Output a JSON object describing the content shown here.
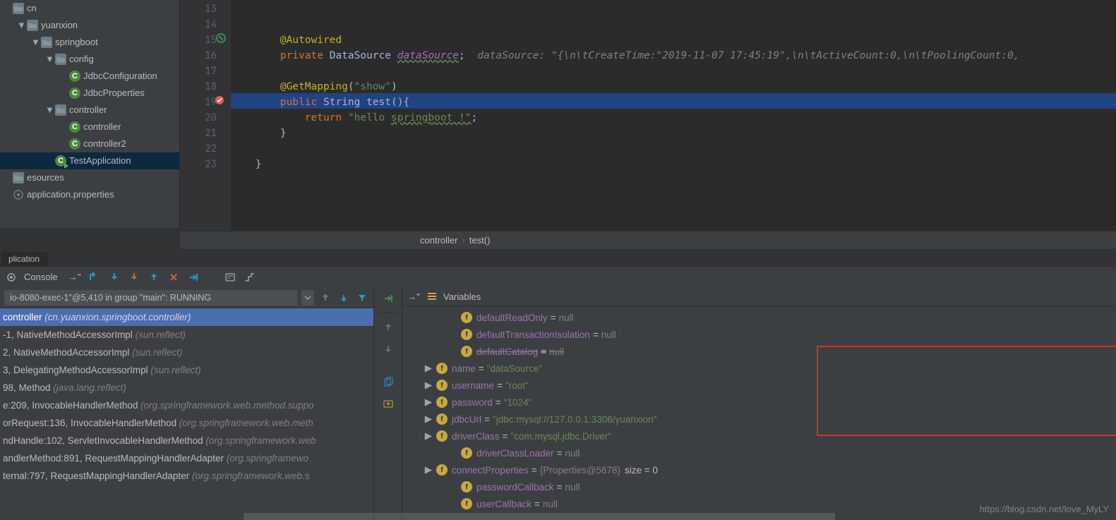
{
  "tree": {
    "items": [
      {
        "depth": 0,
        "chevron": "",
        "iconType": "pkg",
        "label": "cn"
      },
      {
        "depth": 1,
        "chevron": "▼",
        "iconType": "pkg",
        "label": "yuanxion"
      },
      {
        "depth": 2,
        "chevron": "▼",
        "iconType": "pkg",
        "label": "springboot"
      },
      {
        "depth": 3,
        "chevron": "▼",
        "iconType": "pkg",
        "label": "config"
      },
      {
        "depth": 4,
        "chevron": "",
        "iconType": "cls",
        "label": "JdbcConfiguration"
      },
      {
        "depth": 4,
        "chevron": "",
        "iconType": "cls",
        "label": "JdbcProperties"
      },
      {
        "depth": 3,
        "chevron": "▼",
        "iconType": "pkg",
        "label": "controller"
      },
      {
        "depth": 4,
        "chevron": "",
        "iconType": "cls",
        "label": "controller"
      },
      {
        "depth": 4,
        "chevron": "",
        "iconType": "cls",
        "label": "controller2"
      },
      {
        "depth": 3,
        "chevron": "",
        "iconType": "run",
        "label": "TestApplication",
        "selected": true
      },
      {
        "depth": 0,
        "chevron": "",
        "iconType": "pkg",
        "label": "esources"
      },
      {
        "depth": 0,
        "chevron": "",
        "iconType": "prop",
        "label": "application.properties"
      }
    ]
  },
  "gutter": {
    "lines": [
      "13",
      "14",
      "15",
      "16",
      "17",
      "18",
      "19",
      "20",
      "21",
      "22",
      "23"
    ]
  },
  "code": {
    "autowired": "@Autowired",
    "kw_private": "private",
    "type_ds": "DataSource",
    "var_ds": "dataSource",
    "inline_hint": "  dataSource: \"{\\n\\tCreateTime:\"2019-11-07 17:45:19\",\\n\\tActiveCount:0,\\n\\tPoolingCount:0,",
    "getmapping": "@GetMapping",
    "getmapping_arg": "\"show\"",
    "kw_public": "public",
    "type_str": "String",
    "fn_test": "test",
    "open": "(){",
    "kw_return": "return",
    "str_hello": "\"hello ",
    "str_sb": "springboot !\"",
    "brace_c": "}",
    "brace_c2": "}"
  },
  "breadcrumb": {
    "a": "controller",
    "b": "test()"
  },
  "tabs": {
    "active": "plication"
  },
  "toolbar": {
    "console": "Console"
  },
  "thread_text": "io-8080-exec-1\"@5,410 in group \"main\": RUNNING",
  "frames": {
    "top": {
      "a": "controller ",
      "pkg": "(cn.yuanxion.springboot.controller)"
    },
    "rows": [
      {
        "main": "-1, NativeMethodAccessorImpl ",
        "pkg": "(sun.reflect)"
      },
      {
        "main": "2, NativeMethodAccessorImpl ",
        "pkg": "(sun.reflect)"
      },
      {
        "main": "3, DelegatingMethodAccessorImpl ",
        "pkg": "(sun.reflect)"
      },
      {
        "main": "98, Method ",
        "pkg": "(java.lang.reflect)"
      },
      {
        "main": "e:209, InvocableHandlerMethod ",
        "pkg": "(org.springframework.web.method.suppo"
      },
      {
        "main": "orRequest:136, InvocableHandlerMethod ",
        "pkg": "(org.springframework.web.meth"
      },
      {
        "main": "ndHandle:102, ServletInvocableHandlerMethod ",
        "pkg": "(org.springframework.web"
      },
      {
        "main": "andlerMethod:891, RequestMappingHandlerAdapter ",
        "pkg": "(org.springframewo"
      },
      {
        "main": "ternal:797, RequestMappingHandlerAdapter ",
        "pkg": "(org.springframework.web.s"
      }
    ]
  },
  "vars": {
    "header": "Variables",
    "rows": [
      {
        "expand": false,
        "name": "defaultReadOnly",
        "val": "null",
        "vt": "null"
      },
      {
        "expand": false,
        "name": "defaultTransactionIsolation",
        "val": "null",
        "vt": "null"
      },
      {
        "expand": false,
        "name": "defaultCatalog",
        "val": "null",
        "vt": "null",
        "strike": true
      },
      {
        "expand": true,
        "name": "name",
        "val": "\"dataSource\"",
        "vt": "str"
      },
      {
        "expand": true,
        "name": "username",
        "val": "\"root\"",
        "vt": "str"
      },
      {
        "expand": true,
        "name": "password",
        "val": "\"1024\"",
        "vt": "str"
      },
      {
        "expand": true,
        "name": "jdbcUrl",
        "val": "\"jdbc:mysql://127.0.0.1:3306/yuanxion\"",
        "vt": "str"
      },
      {
        "expand": true,
        "name": "driverClass",
        "val": "\"com.mysql.jdbc.Driver\"",
        "vt": "str"
      },
      {
        "expand": false,
        "name": "driverClassLoader",
        "val": "null",
        "vt": "null"
      },
      {
        "expand": true,
        "name": "connectProperties",
        "val": "{Properties@5678}",
        "vt": "obj",
        "extra": " size = 0"
      },
      {
        "expand": false,
        "name": "passwordCallback",
        "val": "null",
        "vt": "null"
      },
      {
        "expand": false,
        "name": "userCallback",
        "val": "null",
        "vt": "null"
      }
    ]
  },
  "watermark": "https://blog.csdn.net/love_MyLY"
}
